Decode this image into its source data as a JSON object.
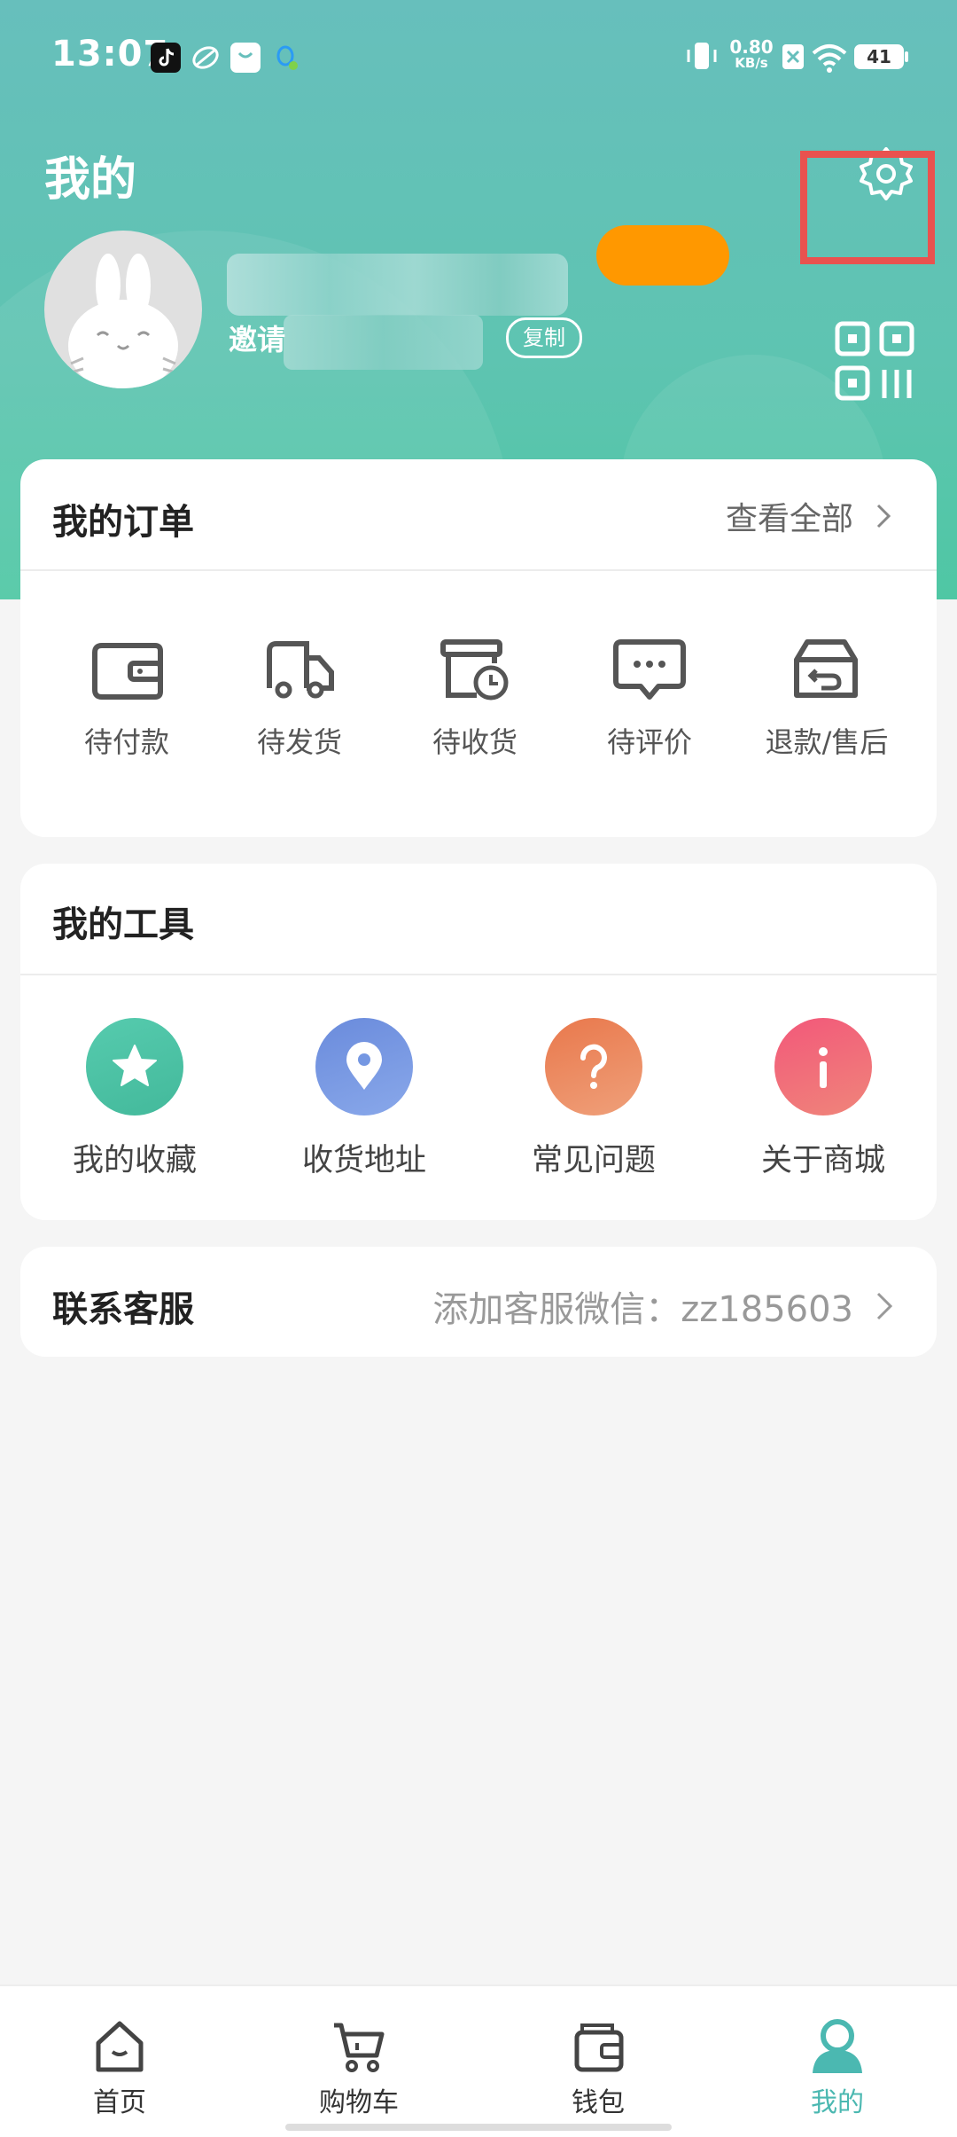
{
  "status_bar": {
    "time": "13:07",
    "net_speed_value": "0.80",
    "net_speed_unit": "KB/s",
    "battery": "41"
  },
  "header": {
    "title": "我的",
    "invite_label": "邀请",
    "copy_label": "复制"
  },
  "orders": {
    "title": "我的订单",
    "view_all": "查看全部",
    "items": [
      {
        "label": "待付款",
        "icon": "wallet-icon"
      },
      {
        "label": "待发货",
        "icon": "truck-icon"
      },
      {
        "label": "待收货",
        "icon": "box-clock-icon"
      },
      {
        "label": "待评价",
        "icon": "comment-icon"
      },
      {
        "label": "退款/售后",
        "icon": "return-box-icon"
      }
    ]
  },
  "tools": {
    "title": "我的工具",
    "items": [
      {
        "label": "我的收藏",
        "icon": "star-icon",
        "color": "#4cc3a4"
      },
      {
        "label": "收货地址",
        "icon": "location-pin-icon",
        "color": "#6e90de"
      },
      {
        "label": "常见问题",
        "icon": "question-icon",
        "color": "#ec8a5a"
      },
      {
        "label": "关于商城",
        "icon": "info-icon",
        "color": "#f0647a"
      }
    ]
  },
  "service": {
    "title": "联系客服",
    "detail": "添加客服微信：zz185603"
  },
  "nav": {
    "items": [
      {
        "label": "首页",
        "icon": "home-icon"
      },
      {
        "label": "购物车",
        "icon": "cart-icon"
      },
      {
        "label": "钱包",
        "icon": "wallet-icon"
      },
      {
        "label": "我的",
        "icon": "profile-icon",
        "active": true
      }
    ]
  },
  "colors": {
    "accent": "#4bb8b1",
    "header_top": "#67bfbc",
    "header_bottom": "#4fc7a4",
    "highlight": "#e9524f",
    "orange": "#ff9800"
  }
}
